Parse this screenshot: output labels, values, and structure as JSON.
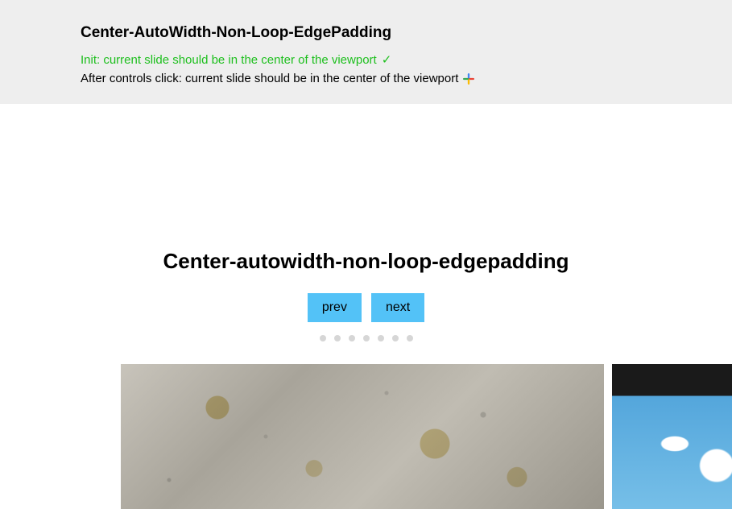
{
  "header": {
    "title": "Center-AutoWidth-Non-Loop-EdgePadding",
    "tests": [
      {
        "text": "Init: current slide should be in the center of the viewport",
        "status": "pass"
      },
      {
        "text": "After controls click: current slide should be in the center of the viewport",
        "status": "running"
      }
    ],
    "check_glyph": "✓"
  },
  "section": {
    "heading": "Center-autowidth-non-loop-edgepadding",
    "controls": {
      "prev_label": "prev",
      "next_label": "next"
    },
    "dot_count": 7,
    "slides": [
      {
        "kind": "concrete",
        "width_class": "slide-a"
      },
      {
        "kind": "sky",
        "width_class": "slide-b"
      }
    ]
  },
  "colors": {
    "pass": "#1dbf1d",
    "button": "#53c2f7",
    "dot": "#d6d6d6",
    "header_bg": "#eeeeee"
  }
}
